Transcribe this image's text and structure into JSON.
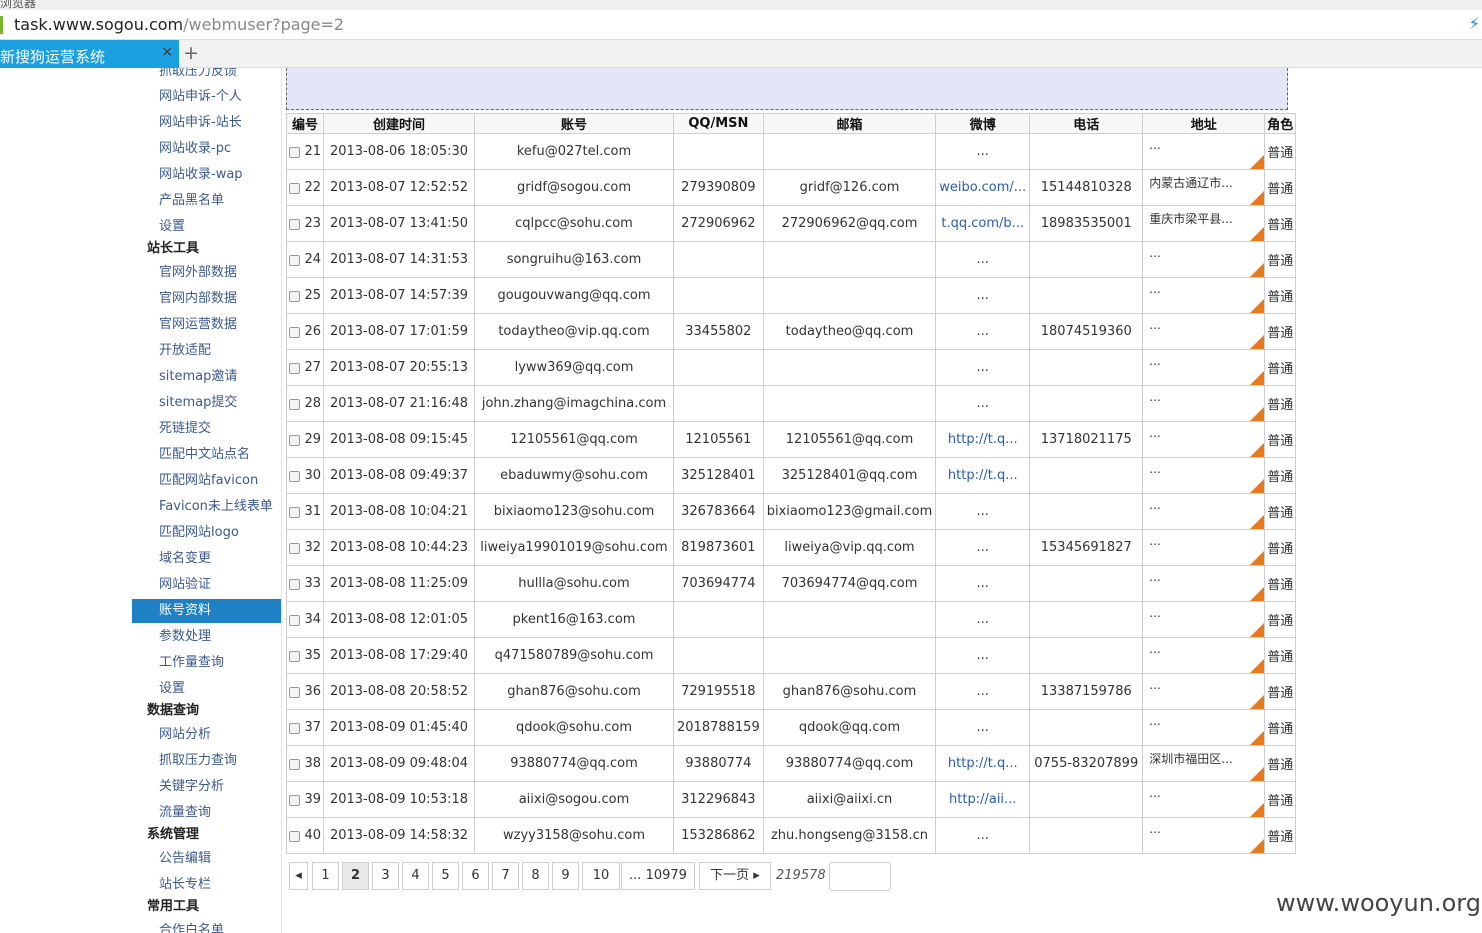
{
  "browser": {
    "top_label": "浏览器",
    "url_host": "task.www.sogou.com",
    "url_path": "/webmuser?page=2",
    "tab_title": "新搜狗运营系统",
    "tab_close": "×",
    "new_tab": "+",
    "bolt": "⚡"
  },
  "sidebar": {
    "entries": [
      {
        "type": "item",
        "label": "抓取压力反馈"
      },
      {
        "type": "item",
        "label": "网站申诉-个人"
      },
      {
        "type": "item",
        "label": "网站申诉-站长"
      },
      {
        "type": "item",
        "label": "网站收录-pc"
      },
      {
        "type": "item",
        "label": "网站收录-wap"
      },
      {
        "type": "item",
        "label": "产品黑名单"
      },
      {
        "type": "item",
        "label": "设置"
      },
      {
        "type": "group",
        "label": "站长工具"
      },
      {
        "type": "item",
        "label": "官网外部数据"
      },
      {
        "type": "item",
        "label": "官网内部数据"
      },
      {
        "type": "item",
        "label": "官网运营数据"
      },
      {
        "type": "item",
        "label": "开放适配"
      },
      {
        "type": "item",
        "label": "sitemap邀请"
      },
      {
        "type": "item",
        "label": "sitemap提交"
      },
      {
        "type": "item",
        "label": "死链提交"
      },
      {
        "type": "item",
        "label": "匹配中文站点名"
      },
      {
        "type": "item",
        "label": "匹配网站favicon"
      },
      {
        "type": "item",
        "label": "Favicon未上线表单"
      },
      {
        "type": "item",
        "label": "匹配网站logo"
      },
      {
        "type": "item",
        "label": "域名变更"
      },
      {
        "type": "item",
        "label": "网站验证"
      },
      {
        "type": "item",
        "label": "账号资料",
        "active": true
      },
      {
        "type": "item",
        "label": "参数处理"
      },
      {
        "type": "item",
        "label": "工作量查询"
      },
      {
        "type": "item",
        "label": "设置"
      },
      {
        "type": "group",
        "label": "数据查询"
      },
      {
        "type": "item",
        "label": "网站分析"
      },
      {
        "type": "item",
        "label": "抓取压力查询"
      },
      {
        "type": "item",
        "label": "关键字分析"
      },
      {
        "type": "item",
        "label": "流量查询"
      },
      {
        "type": "group",
        "label": "系统管理"
      },
      {
        "type": "item",
        "label": "公告编辑"
      },
      {
        "type": "item",
        "label": "站长专栏"
      },
      {
        "type": "group",
        "label": "常用工具"
      },
      {
        "type": "item",
        "label": "合作白名单"
      }
    ]
  },
  "table": {
    "headers": [
      "编号",
      "创建时间",
      "账号",
      "QQ/MSN",
      "邮箱",
      "微博",
      "电话",
      "地址",
      "角色"
    ],
    "rows": [
      {
        "id": "21",
        "created": "2013-08-06 18:05:30",
        "account": "kefu@027tel.com",
        "qq": "",
        "email": "",
        "weibo": "...",
        "weibo_link": false,
        "phone": "",
        "address": "...",
        "role": "普通"
      },
      {
        "id": "22",
        "created": "2013-08-07 12:52:52",
        "account": "gridf@sogou.com",
        "qq": "279390809",
        "email": "gridf@126.com",
        "weibo": "weibo.com/...",
        "weibo_link": true,
        "phone": "15144810328",
        "address": "内蒙古通辽市...",
        "role": "普通"
      },
      {
        "id": "23",
        "created": "2013-08-07 13:41:50",
        "account": "cqlpcc@sohu.com",
        "qq": "272906962",
        "email": "272906962@qq.com",
        "weibo": "t.qq.com/b...",
        "weibo_link": true,
        "phone": "18983535001",
        "address": "重庆市梁平县...",
        "role": "普通"
      },
      {
        "id": "24",
        "created": "2013-08-07 14:31:53",
        "account": "songruihu@163.com",
        "qq": "",
        "email": "",
        "weibo": "...",
        "weibo_link": false,
        "phone": "",
        "address": "...",
        "role": "普通"
      },
      {
        "id": "25",
        "created": "2013-08-07 14:57:39",
        "account": "gougouvwang@qq.com",
        "qq": "",
        "email": "",
        "weibo": "...",
        "weibo_link": false,
        "phone": "",
        "address": "...",
        "role": "普通"
      },
      {
        "id": "26",
        "created": "2013-08-07 17:01:59",
        "account": "todaytheo@vip.qq.com",
        "qq": "33455802",
        "email": "todaytheo@qq.com",
        "weibo": "...",
        "weibo_link": false,
        "phone": "18074519360",
        "address": "...",
        "role": "普通"
      },
      {
        "id": "27",
        "created": "2013-08-07 20:55:13",
        "account": "lyww369@qq.com",
        "qq": "",
        "email": "",
        "weibo": "...",
        "weibo_link": false,
        "phone": "",
        "address": "...",
        "role": "普通"
      },
      {
        "id": "28",
        "created": "2013-08-07 21:16:48",
        "account": "john.zhang@imagchina.com",
        "qq": "",
        "email": "",
        "weibo": "...",
        "weibo_link": false,
        "phone": "",
        "address": "...",
        "role": "普通"
      },
      {
        "id": "29",
        "created": "2013-08-08 09:15:45",
        "account": "12105561@qq.com",
        "qq": "12105561",
        "email": "12105561@qq.com",
        "weibo": "http://t.q...",
        "weibo_link": true,
        "phone": "13718021175",
        "address": "...",
        "role": "普通"
      },
      {
        "id": "30",
        "created": "2013-08-08 09:49:37",
        "account": "ebaduwmy@sohu.com",
        "qq": "325128401",
        "email": "325128401@qq.com",
        "weibo": "http://t.q...",
        "weibo_link": true,
        "phone": "",
        "address": "...",
        "role": "普通"
      },
      {
        "id": "31",
        "created": "2013-08-08 10:04:21",
        "account": "bixiaomo123@sohu.com",
        "qq": "326783664",
        "email": "bixiaomo123@gmail.com",
        "weibo": "...",
        "weibo_link": false,
        "phone": "",
        "address": "...",
        "role": "普通"
      },
      {
        "id": "32",
        "created": "2013-08-08 10:44:23",
        "account": "liweiya19901019@sohu.com",
        "qq": "819873601",
        "email": "liweiya@vip.qq.com",
        "weibo": "...",
        "weibo_link": false,
        "phone": "15345691827",
        "address": "...",
        "role": "普通"
      },
      {
        "id": "33",
        "created": "2013-08-08 11:25:09",
        "account": "hullla@sohu.com",
        "qq": "703694774",
        "email": "703694774@qq.com",
        "weibo": "...",
        "weibo_link": false,
        "phone": "",
        "address": "...",
        "role": "普通"
      },
      {
        "id": "34",
        "created": "2013-08-08 12:01:05",
        "account": "pkent16@163.com",
        "qq": "",
        "email": "",
        "weibo": "...",
        "weibo_link": false,
        "phone": "",
        "address": "...",
        "role": "普通"
      },
      {
        "id": "35",
        "created": "2013-08-08 17:29:40",
        "account": "q471580789@sohu.com",
        "qq": "",
        "email": "",
        "weibo": "...",
        "weibo_link": false,
        "phone": "",
        "address": "...",
        "role": "普通"
      },
      {
        "id": "36",
        "created": "2013-08-08 20:58:52",
        "account": "ghan876@sohu.com",
        "qq": "729195518",
        "email": "ghan876@sohu.com",
        "weibo": "...",
        "weibo_link": false,
        "phone": "13387159786",
        "address": "...",
        "role": "普通"
      },
      {
        "id": "37",
        "created": "2013-08-09 01:45:40",
        "account": "qdook@sohu.com",
        "qq": "2018788159",
        "email": "qdook@qq.com",
        "weibo": "...",
        "weibo_link": false,
        "phone": "",
        "address": "...",
        "role": "普通"
      },
      {
        "id": "38",
        "created": "2013-08-09 09:48:04",
        "account": "93880774@qq.com",
        "qq": "93880774",
        "email": "93880774@qq.com",
        "weibo": "http://t.q...",
        "weibo_link": true,
        "phone": "0755-83207899",
        "address": "深圳市福田区...",
        "role": "普通"
      },
      {
        "id": "39",
        "created": "2013-08-09 10:53:18",
        "account": "aiixi@sogou.com",
        "qq": "312296843",
        "email": "aiixi@aiixi.cn",
        "weibo": "http://aii...",
        "weibo_link": true,
        "phone": "",
        "address": "...",
        "role": "普通"
      },
      {
        "id": "40",
        "created": "2013-08-09 14:58:32",
        "account": "wzyy3158@sohu.com",
        "qq": "153286862",
        "email": "zhu.hongseng@3158.cn",
        "weibo": "...",
        "weibo_link": false,
        "phone": "",
        "address": "...",
        "role": "普通"
      }
    ]
  },
  "pager": {
    "prev": "◂",
    "pages": [
      "1",
      "2",
      "3",
      "4",
      "5",
      "6",
      "7",
      "8",
      "9",
      "10"
    ],
    "current": "2",
    "last": "... 10979",
    "next": "下一页 ▸",
    "total": "219578"
  },
  "watermark": "www.wooyun.org",
  "colors": {
    "tab_bg": "#1a9fe0",
    "sidebar_active": "#1e80c5",
    "corner_marker": "#e87a1c",
    "link": "#2a5db0"
  }
}
